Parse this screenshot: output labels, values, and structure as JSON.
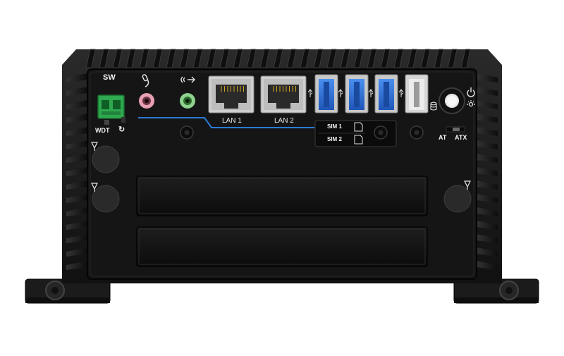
{
  "product": {
    "labels": {
      "power_switch": "SW",
      "watchdog": "WDT",
      "lan1": "LAN 1",
      "lan2": "LAN 2",
      "sim1": "SIM 1",
      "sim2": "SIM 2",
      "at_mode": "AT",
      "atx_mode": "ATX"
    },
    "icons": {
      "mic": "microphone-icon",
      "line_out": "line-out-icon",
      "usb": "usb-icon",
      "power": "power-icon",
      "hdd_led": "storage-led-icon",
      "antenna": "antenna-icon",
      "reset": "reset-icon"
    },
    "colors": {
      "chassis": "#1a1a1a",
      "panel": "#121212",
      "terminal_block": "#2fa84f",
      "mic_jack": "#e8a0b4",
      "line_out_jack": "#8fd18f",
      "usb3_blue": "#2f6fd6",
      "accent_line": "#2b7bd8"
    }
  }
}
